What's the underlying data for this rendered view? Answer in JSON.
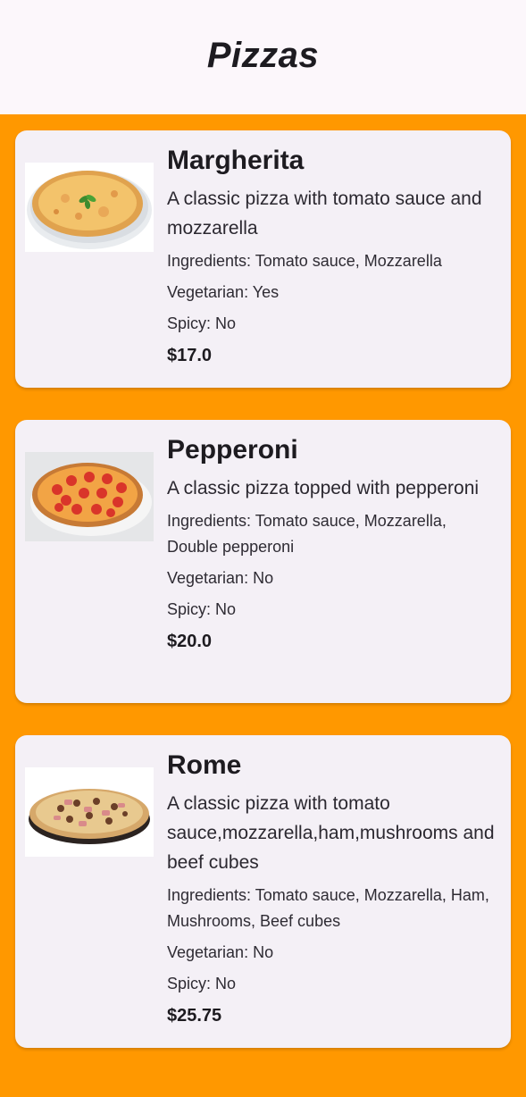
{
  "app_bar": {
    "title": "Pizzas"
  },
  "pizzas": [
    {
      "image": "margherita-pizza-photo",
      "name": "Margherita",
      "description": "A classic pizza with tomato sauce and mozzarella",
      "ingredients": "Ingredients: Tomato sauce, Mozzarella",
      "vegetarian": "Vegetarian: Yes",
      "spicy": "Spicy: No",
      "price": "$17.0"
    },
    {
      "image": "pepperoni-pizza-photo",
      "name": "Pepperoni",
      "description": "A classic pizza topped with pepperoni",
      "ingredients": "Ingredients: Tomato sauce, Mozzarella, Double pepperoni",
      "vegetarian": "Vegetarian: No",
      "spicy": "Spicy: No",
      "price": "$20.0"
    },
    {
      "image": "rome-pizza-photo",
      "name": "Rome",
      "description": "A classic pizza with tomato sauce,mozzarella,ham,mushrooms and beef cubes",
      "ingredients": "Ingredients: Tomato sauce, Mozzarella, Ham, Mushrooms, Beef cubes",
      "vegetarian": "Vegetarian: No",
      "spicy": "Spicy: No",
      "price": "$25.75"
    }
  ],
  "colors": {
    "background": "#ff9800",
    "app_bar": "#fcf7fb",
    "card": "#f4f0f6"
  }
}
